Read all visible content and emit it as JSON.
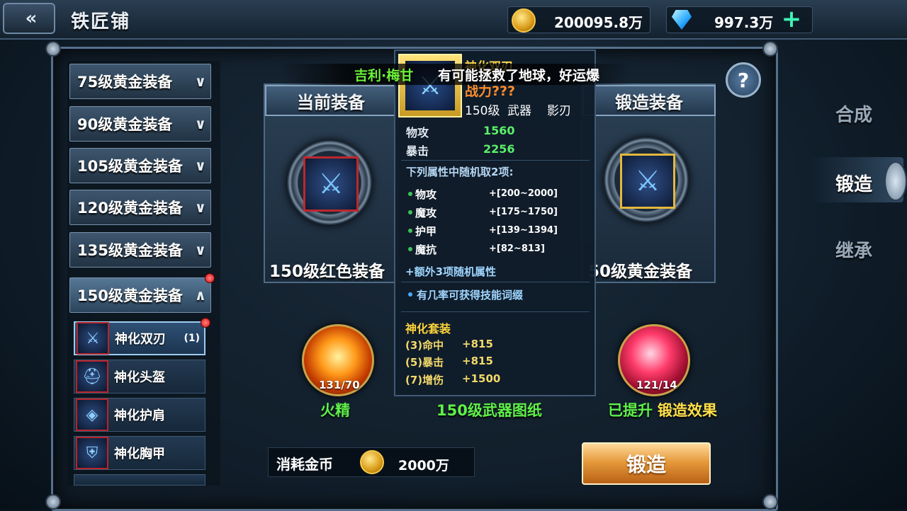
{
  "header": {
    "back_icon": "double-chevron-left-icon",
    "title": "铁匠铺",
    "gold": "200095.8万",
    "diamonds": "997.3万",
    "add_icon": "plus-icon"
  },
  "categories": [
    {
      "label": "75级黄金装备",
      "icon": "chevron-down-icon"
    },
    {
      "label": "90级黄金装备",
      "icon": "chevron-down-icon"
    },
    {
      "label": "105级黄金装备",
      "icon": "chevron-down-icon"
    },
    {
      "label": "120级黄金装备",
      "icon": "chevron-down-icon"
    },
    {
      "label": "135级黄金装备",
      "icon": "chevron-down-icon"
    },
    {
      "label": "150级黄金装备",
      "icon": "chevron-up-icon"
    }
  ],
  "items": [
    {
      "name": "神化双刃",
      "count": "(1)"
    },
    {
      "name": "神化头盔",
      "count": ""
    },
    {
      "name": "神化护肩",
      "count": ""
    },
    {
      "name": "神化胸甲",
      "count": ""
    }
  ],
  "current_card": {
    "title": "当前装备",
    "footer": "150级红色装备"
  },
  "forge_card": {
    "title": "锻造装备",
    "footer": "50级黄金装备"
  },
  "materials": {
    "fire": {
      "count": "131/70",
      "label": "火精"
    },
    "blueprint": {
      "label": "150级武器图纸"
    },
    "gem": {
      "count": "121/14",
      "label_a": "已提升",
      "label_b": "锻造效果"
    }
  },
  "cost": {
    "label": "消耗金币",
    "value": "2000万"
  },
  "forge_button": "锻造",
  "side_tabs": [
    "合成",
    "锻造",
    "继承"
  ],
  "marquee": {
    "green": "吉利·梅甘",
    "white": "有可能拯救了地球，好运爆"
  },
  "tooltip": {
    "title": "神化双刃",
    "power": "战力???",
    "level": "150级",
    "type": "武器",
    "job": "影刃",
    "base_stats": [
      {
        "k": "物攻",
        "v": "1560"
      },
      {
        "k": "暴击",
        "v": "2256"
      }
    ],
    "random_head": "下列属性中随机取2项:",
    "random_stats": [
      {
        "k": "物攻",
        "v": "+[200~2000]"
      },
      {
        "k": "魔攻",
        "v": "+[175~1750]"
      },
      {
        "k": "护甲",
        "v": "+[139~1394]"
      },
      {
        "k": "魔抗",
        "v": "+[82~813]"
      }
    ],
    "extra": "+额外3项随机属性",
    "skill": "有几率可获得技能词缀",
    "set_title": "神化套装",
    "set_bonus": [
      {
        "k": "(3)命中",
        "v": "+815"
      },
      {
        "k": "(5)暴击",
        "v": "+815"
      },
      {
        "k": "(7)增伤",
        "v": "+1500"
      }
    ]
  }
}
